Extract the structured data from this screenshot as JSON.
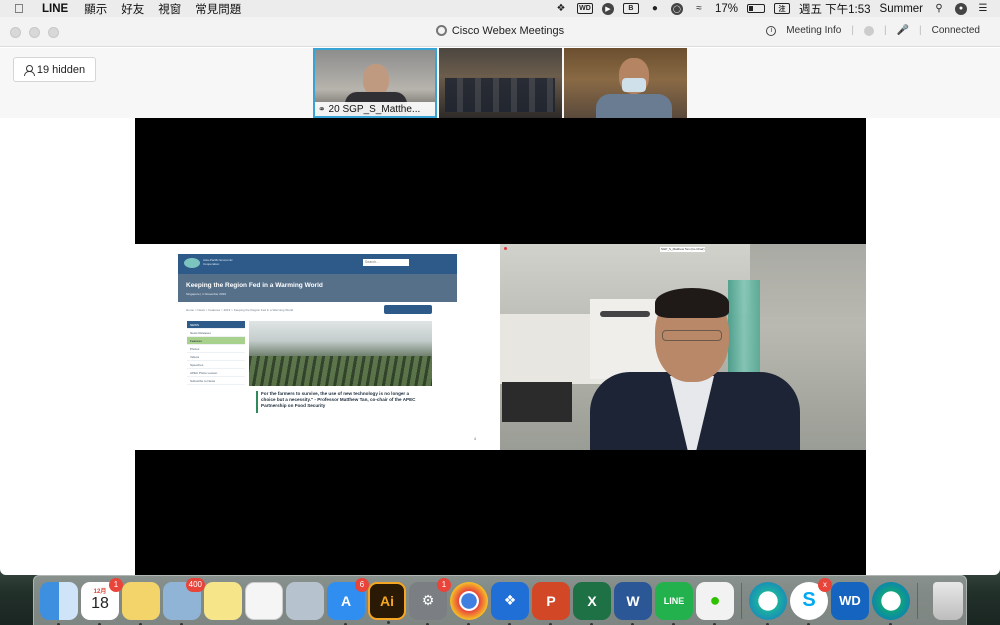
{
  "menubar": {
    "app_name": "LINE",
    "menus": [
      "顯示",
      "好友",
      "視窗",
      "常見問題"
    ],
    "battery": "17%",
    "clock": "週五 下午1:53",
    "user": "Summer"
  },
  "window": {
    "title": "Cisco Webex Meetings",
    "meeting_info": "Meeting Info",
    "status": "Connected"
  },
  "participants": {
    "hidden_label": "19 hidden",
    "thumbnails": [
      {
        "label": "20 SGP_S_Matthe..."
      },
      {
        "label": ""
      },
      {
        "label": ""
      }
    ]
  },
  "shared_slide": {
    "site_name": "Asia-Pacific Economic Cooperation",
    "search_placeholder": "Search...",
    "title": "Keeping the Region Fed in a Warming World",
    "subtitle": "Singapore | 1 November 2019",
    "breadcrumb": "Home > News > Features > 2019 > Keeping the Region Fed in a Warming World",
    "side_menu": [
      "NEWS",
      "News Releases",
      "Features",
      "Photos",
      "Videos",
      "Speeches",
      "APEC Photo Lesson",
      "Subscribe to News"
    ],
    "quote": "For the farmers to survive, the use of new technology is no longer a choice but a necessity.\" - Professor Matthew Tan, co-chair of the APEC Partnership on Food Security",
    "page_number": "4"
  },
  "speaker": {
    "tag": "SGP_S_Matthew Tan (Co-Chair)"
  },
  "dock": {
    "calendar_month": "12月",
    "calendar_day": "18",
    "calendar_badge": "1",
    "photos_badge": "400",
    "appstore_badge": "6",
    "prefs_badge": "1",
    "skype_badge": "x",
    "items": [
      "finder-icon",
      "calendar-icon",
      "stickies-icon",
      "mail-icon",
      "notes-icon",
      "reminders-icon",
      "preview-icon",
      "appstore-icon",
      "illustrator-icon",
      "system-preferences-icon",
      "chrome-icon",
      "dropbox-icon",
      "powerpoint-icon",
      "excel-icon",
      "word-icon",
      "line-icon",
      "wechat-icon",
      "webex-icon",
      "skype-icon",
      "wd-icon",
      "webex-meetings-icon",
      "trash-icon"
    ]
  }
}
